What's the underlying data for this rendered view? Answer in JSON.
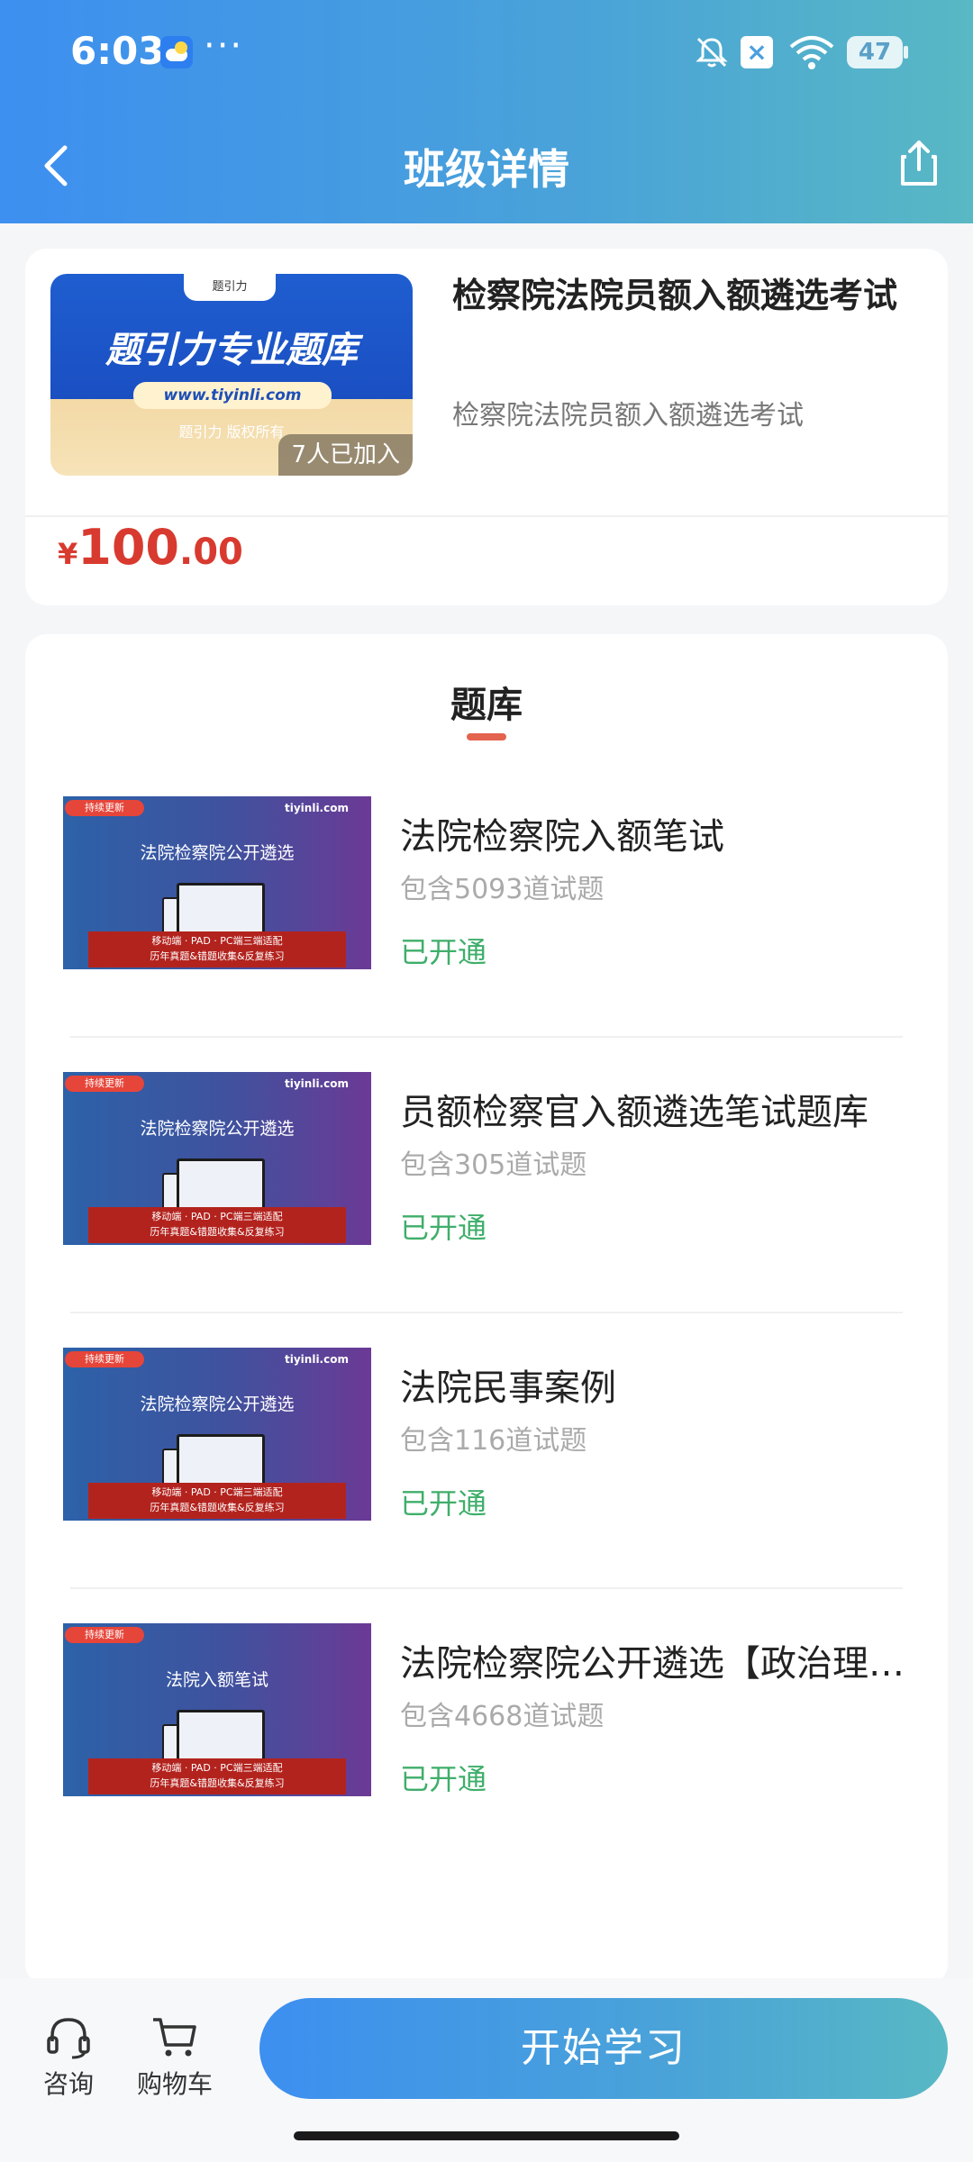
{
  "status_bar": {
    "time": "6:03",
    "more": "···",
    "battery": "47"
  },
  "header": {
    "title": "班级详情"
  },
  "course": {
    "cover_tab": "题引力",
    "cover_brand": "题引力专业题库",
    "cover_url": "www.tiyinli.com",
    "cover_copyright": "题引力 版权所有",
    "joined": "7人已加入",
    "title": "检察院法院员额入额遴选考试",
    "subtitle": "检察院法院员额入额遴选考试",
    "price_symbol": "¥",
    "price_integer": "100",
    "price_decimal": ".00"
  },
  "question_bank": {
    "section_title": "题库",
    "items": [
      {
        "name": "法院检察院入额笔试",
        "count": "包含5093道试题",
        "status": "已开通",
        "thumb_tag": "持续更新",
        "thumb_logo": "tiyinli.com",
        "thumb_title": "法院检察院公开遴选",
        "thumb_banner_1": "移动端 · PAD · PC端三端适配",
        "thumb_banner_2": "历年真题&错题收集&反复练习"
      },
      {
        "name": "员额检察官入额遴选笔试题库",
        "count": "包含305道试题",
        "status": "已开通",
        "thumb_tag": "持续更新",
        "thumb_logo": "tiyinli.com",
        "thumb_title": "法院检察院公开遴选",
        "thumb_banner_1": "移动端 · PAD · PC端三端适配",
        "thumb_banner_2": "历年真题&错题收集&反复练习"
      },
      {
        "name": "法院民事案例",
        "count": "包含116道试题",
        "status": "已开通",
        "thumb_tag": "持续更新",
        "thumb_logo": "tiyinli.com",
        "thumb_title": "法院检察院公开遴选",
        "thumb_banner_1": "移动端 · PAD · PC端三端适配",
        "thumb_banner_2": "历年真题&错题收集&反复练习"
      },
      {
        "name": "法院检察院公开遴选【政治理论】",
        "count": "包含4668道试题",
        "status": "已开通",
        "thumb_tag": "持续更新",
        "thumb_logo": "",
        "thumb_title": "法院入额笔试",
        "thumb_banner_1": "移动端 · PAD · PC端三端适配",
        "thumb_banner_2": "历年真题&错题收集&反复练习"
      }
    ]
  },
  "bottom_bar": {
    "consult_label": "咨询",
    "cart_label": "购物车",
    "start_label": "开始学习"
  },
  "colors": {
    "accent_gradient_start": "#3d8ff0",
    "accent_gradient_end": "#58b8c4",
    "price_red": "#d83a2f",
    "status_green": "#3fae6a",
    "tab_underline": "#e4634e"
  }
}
